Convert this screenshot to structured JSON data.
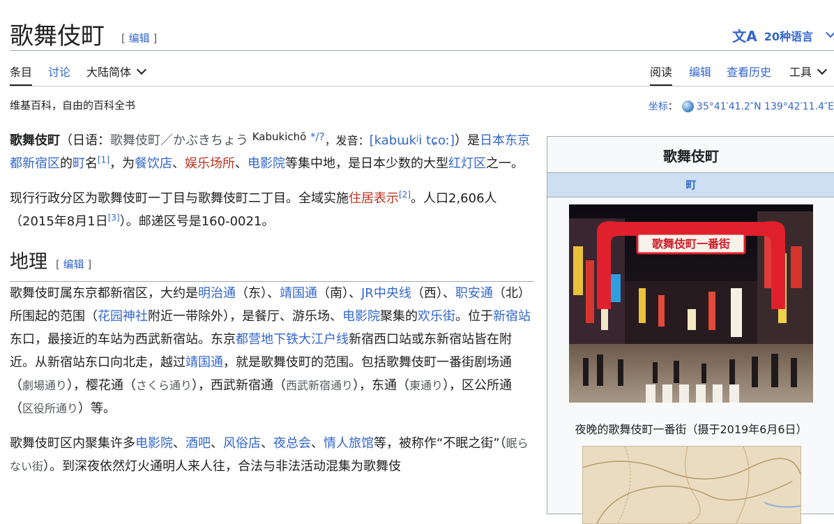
{
  "page": {
    "title": "歌舞伎町",
    "edit_label": "编辑",
    "languages_label": "20种语言",
    "language_icon_glyph": "文A"
  },
  "tabs": {
    "article": "条目",
    "talk": "讨论",
    "variant": "大陆简体",
    "read": "阅读",
    "edit": "编辑",
    "history": "查看历史",
    "tools": "工具"
  },
  "tagline": "维基百科，自由的百科全书",
  "coordinates": {
    "label": "坐标",
    "value": "35°41′41.2″N 139°42′11.4″E"
  },
  "lead": {
    "term": "歌舞伎町",
    "paren_open": "（日语：",
    "ja_text": "歌舞伎町／かぶきちょう",
    "romaji": "Kabukichō",
    "romaji_mark": "*/?",
    "pron_label": "，发音：",
    "ipa": "[kabɯkʲi tɕoː]",
    "paren_close": "）是",
    "link_japan": "日本",
    "link_tokyo": "东京都",
    "link_shinjuku": "新宿区",
    "text_de": "的",
    "link_machi": "町",
    "text_ming": "名",
    "ref1": "[1]",
    "text_wei": "，为",
    "link_restaurant": "餐饮店",
    "sep1": "、",
    "link_amusement": "娱乐场所",
    "sep2": "、",
    "link_cinema": "电影院",
    "text_rest": "等集中地，是日本少数的大型",
    "link_redlight": "红灯区",
    "text_end": "之一。"
  },
  "para2": {
    "text1": "现行行政分区为歌舞伎町一丁目与歌舞伎町二丁目。全域实施",
    "link_address": "住居表示",
    "ref2": "[2]",
    "text2": "。人口2,606人（2015年8月1日",
    "ref3": "[3]",
    "text3": "）。邮递区号是160-0021。"
  },
  "section": {
    "heading": "地理",
    "edit_label": "编辑"
  },
  "geo": {
    "t1": "歌舞伎町属东京都新宿区，大约是",
    "l_meiji": "明治通",
    "t2": "（东）、",
    "l_yasukuni": "靖国通",
    "t3": "（南）、",
    "l_jr": "JR中央线",
    "t4": "（西）、",
    "l_shokuan": "职安通",
    "t5": "（北）所围起的范围（",
    "l_hanazono": "花园神社",
    "t6": "附近一带除外），是餐厅、游乐场、",
    "l_cinema": "电影院",
    "t7": "聚集的",
    "l_huanle": "欢乐街",
    "t8": "。位于",
    "l_station": "新宿站",
    "t9": "东口，最接近的车站为西武新宿站。东京",
    "l_oedo": "都营地下铁大江户线",
    "t10": "新宿西口站或东新宿站皆在附近。从新宿站东口向北走，越过",
    "l_yasukuni2": "靖国通",
    "t11": "，就是歌舞伎町的范围。包括歌舞伎町一番街剧场通（",
    "j1": "劇場通り",
    "t12": "），樱花通（",
    "j2": "さくら通り",
    "t13": "），西武新宿通（",
    "j3": "西武新宿通り",
    "t14": "），东通（",
    "j4": "東通り",
    "t15": "），区公所通（",
    "j5": "区役所通り",
    "t16": "）等。"
  },
  "para4": {
    "t1": "歌舞伎町区内聚集许多",
    "l_cinema": "电影院",
    "s1": "、",
    "l_bar": "酒吧",
    "s2": "、",
    "l_fuzoku": "风俗店",
    "s3": "、",
    "l_club": "夜总会",
    "s4": "、",
    "l_hotel": "情人旅馆",
    "t2": "等，被称作“不眠",
    "t3": "之街”（",
    "j1": "眠らない街",
    "t4": "）。到深夜依然灯火通明人来人往，合法与非法活动混集为歌舞伎"
  },
  "infobox": {
    "title": "歌舞伎町",
    "subtitle": "町",
    "photo_sign": "歌舞伎町一番街",
    "caption": "夜晚的歌舞伎町一番街（摄于2019年6月6日）"
  },
  "colors": {
    "link": "#3366cc",
    "redlink": "#ba3320",
    "infobox_header": "#cedff2",
    "sign_red": "#e0202c"
  }
}
